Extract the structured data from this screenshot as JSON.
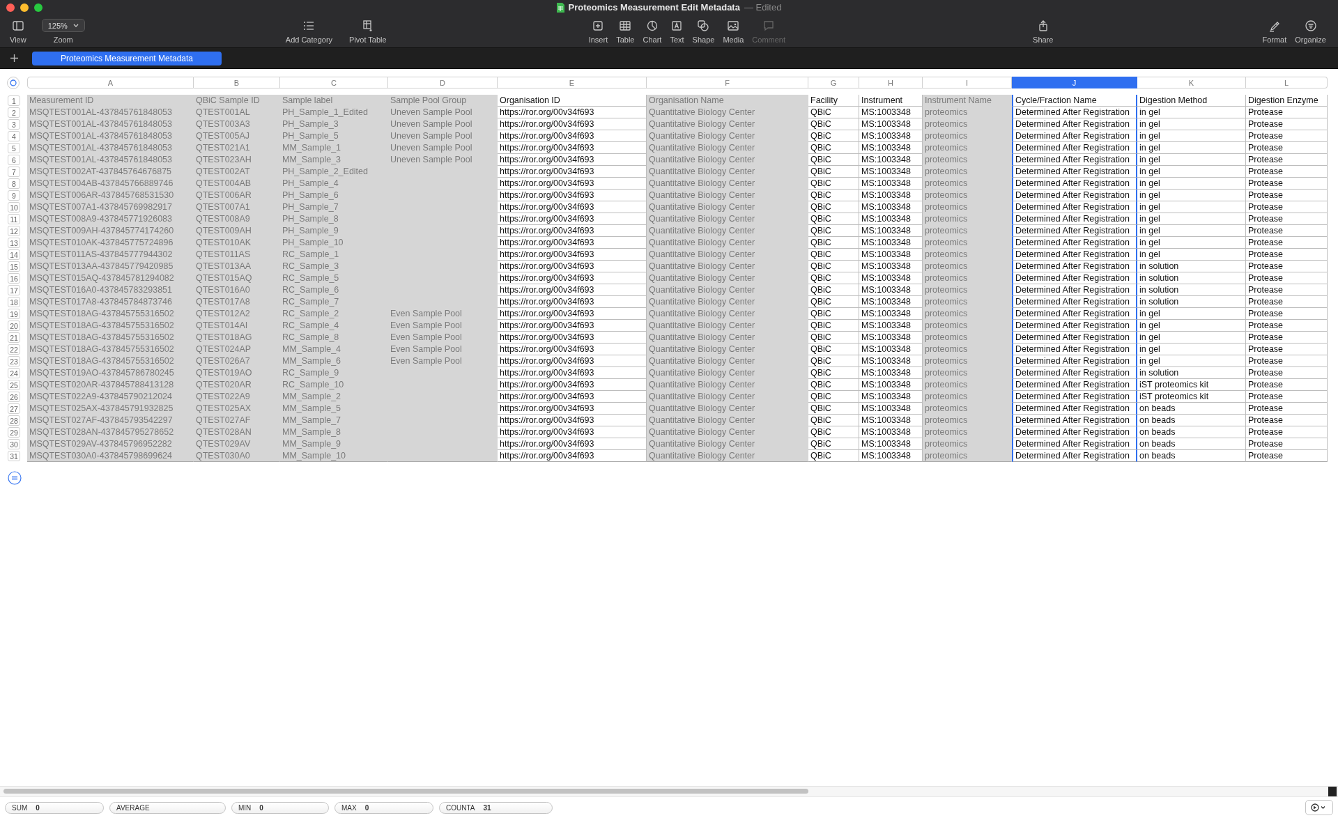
{
  "window": {
    "title": "Proteomics Measurement Edit Metadata",
    "status": "— Edited"
  },
  "toolbar": {
    "zoom_value": "125%",
    "items": [
      {
        "label": "View",
        "disabled": false
      },
      {
        "label": "Zoom",
        "disabled": false
      },
      {
        "label": "Add Category",
        "disabled": false
      },
      {
        "label": "Pivot Table",
        "disabled": false
      },
      {
        "label": "Insert",
        "disabled": false
      },
      {
        "label": "Table",
        "disabled": false
      },
      {
        "label": "Chart",
        "disabled": false
      },
      {
        "label": "Text",
        "disabled": false
      },
      {
        "label": "Shape",
        "disabled": false
      },
      {
        "label": "Media",
        "disabled": false
      },
      {
        "label": "Comment",
        "disabled": true
      },
      {
        "label": "Share",
        "disabled": false
      },
      {
        "label": "Format",
        "disabled": false
      },
      {
        "label": "Organize",
        "disabled": false
      }
    ]
  },
  "sheet_tabs": [
    {
      "label": "Proteomics Measurement Metadata",
      "selected": true
    }
  ],
  "table": {
    "columns": [
      {
        "letter": "A",
        "header": "Measurement ID",
        "editable": false,
        "selected": false
      },
      {
        "letter": "B",
        "header": "QBiC Sample ID",
        "editable": false,
        "selected": false
      },
      {
        "letter": "C",
        "header": "Sample label",
        "editable": false,
        "selected": false
      },
      {
        "letter": "D",
        "header": "Sample Pool Group",
        "editable": false,
        "selected": false
      },
      {
        "letter": "E",
        "header": "Organisation ID",
        "editable": true,
        "selected": false
      },
      {
        "letter": "F",
        "header": "Organisation Name",
        "editable": false,
        "selected": false
      },
      {
        "letter": "G",
        "header": "Facility",
        "editable": true,
        "selected": false
      },
      {
        "letter": "H",
        "header": "Instrument",
        "editable": true,
        "selected": false
      },
      {
        "letter": "I",
        "header": "Instrument Name",
        "editable": false,
        "selected": false
      },
      {
        "letter": "J",
        "header": "Cycle/Fraction Name",
        "editable": true,
        "selected": true
      },
      {
        "letter": "K",
        "header": "Digestion Method",
        "editable": true,
        "selected": false
      },
      {
        "letter": "L",
        "header": "Digestion Enzyme",
        "editable": true,
        "selected": false
      }
    ],
    "header_row_number": "1",
    "rows": [
      {
        "number": "2",
        "cells": [
          "MSQTEST001AL-437845761848053",
          "QTEST001AL",
          "PH_Sample_1_Edited",
          "Uneven Sample Pool",
          "https://ror.org/00v34f693",
          "Quantitative Biology Center",
          "QBiC",
          "MS:1003348",
          "proteomics",
          "Determined After Registration",
          "in gel",
          "Protease"
        ]
      },
      {
        "number": "3",
        "cells": [
          "MSQTEST001AL-437845761848053",
          "QTEST003A3",
          "PH_Sample_3",
          "Uneven Sample Pool",
          "https://ror.org/00v34f693",
          "Quantitative Biology Center",
          "QBiC",
          "MS:1003348",
          "proteomics",
          "Determined After Registration",
          "in gel",
          "Protease"
        ]
      },
      {
        "number": "4",
        "cells": [
          "MSQTEST001AL-437845761848053",
          "QTEST005AJ",
          "PH_Sample_5",
          "Uneven Sample Pool",
          "https://ror.org/00v34f693",
          "Quantitative Biology Center",
          "QBiC",
          "MS:1003348",
          "proteomics",
          "Determined After Registration",
          "in gel",
          "Protease"
        ]
      },
      {
        "number": "5",
        "cells": [
          "MSQTEST001AL-437845761848053",
          "QTEST021A1",
          "MM_Sample_1",
          "Uneven Sample Pool",
          "https://ror.org/00v34f693",
          "Quantitative Biology Center",
          "QBiC",
          "MS:1003348",
          "proteomics",
          "Determined After Registration",
          "in gel",
          "Protease"
        ]
      },
      {
        "number": "6",
        "cells": [
          "MSQTEST001AL-437845761848053",
          "QTEST023AH",
          "MM_Sample_3",
          "Uneven Sample Pool",
          "https://ror.org/00v34f693",
          "Quantitative Biology Center",
          "QBiC",
          "MS:1003348",
          "proteomics",
          "Determined After Registration",
          "in gel",
          "Protease"
        ]
      },
      {
        "number": "7",
        "cells": [
          "MSQTEST002AT-437845764676875",
          "QTEST002AT",
          "PH_Sample_2_Edited",
          null,
          "https://ror.org/00v34f693",
          "Quantitative Biology Center",
          "QBiC",
          "MS:1003348",
          "proteomics",
          "Determined After Registration",
          "in gel",
          "Protease"
        ]
      },
      {
        "number": "8",
        "cells": [
          "MSQTEST004AB-437845766889746",
          "QTEST004AB",
          "PH_Sample_4",
          null,
          "https://ror.org/00v34f693",
          "Quantitative Biology Center",
          "QBiC",
          "MS:1003348",
          "proteomics",
          "Determined After Registration",
          "in gel",
          "Protease"
        ]
      },
      {
        "number": "9",
        "cells": [
          "MSQTEST006AR-437845768531530",
          "QTEST006AR",
          "PH_Sample_6",
          null,
          "https://ror.org/00v34f693",
          "Quantitative Biology Center",
          "QBiC",
          "MS:1003348",
          "proteomics",
          "Determined After Registration",
          "in gel",
          "Protease"
        ]
      },
      {
        "number": "10",
        "cells": [
          "MSQTEST007A1-437845769982917",
          "QTEST007A1",
          "PH_Sample_7",
          null,
          "https://ror.org/00v34f693",
          "Quantitative Biology Center",
          "QBiC",
          "MS:1003348",
          "proteomics",
          "Determined After Registration",
          "in gel",
          "Protease"
        ]
      },
      {
        "number": "11",
        "cells": [
          "MSQTEST008A9-437845771926083",
          "QTEST008A9",
          "PH_Sample_8",
          null,
          "https://ror.org/00v34f693",
          "Quantitative Biology Center",
          "QBiC",
          "MS:1003348",
          "proteomics",
          "Determined After Registration",
          "in gel",
          "Protease"
        ]
      },
      {
        "number": "12",
        "cells": [
          "MSQTEST009AH-437845774174260",
          "QTEST009AH",
          "PH_Sample_9",
          null,
          "https://ror.org/00v34f693",
          "Quantitative Biology Center",
          "QBiC",
          "MS:1003348",
          "proteomics",
          "Determined After Registration",
          "in gel",
          "Protease"
        ]
      },
      {
        "number": "13",
        "cells": [
          "MSQTEST010AK-437845775724896",
          "QTEST010AK",
          "PH_Sample_10",
          null,
          "https://ror.org/00v34f693",
          "Quantitative Biology Center",
          "QBiC",
          "MS:1003348",
          "proteomics",
          "Determined After Registration",
          "in gel",
          "Protease"
        ]
      },
      {
        "number": "14",
        "cells": [
          "MSQTEST011AS-437845777944302",
          "QTEST011AS",
          "RC_Sample_1",
          null,
          "https://ror.org/00v34f693",
          "Quantitative Biology Center",
          "QBiC",
          "MS:1003348",
          "proteomics",
          "Determined After Registration",
          "in gel",
          "Protease"
        ]
      },
      {
        "number": "15",
        "cells": [
          "MSQTEST013AA-437845779420985",
          "QTEST013AA",
          "RC_Sample_3",
          null,
          "https://ror.org/00v34f693",
          "Quantitative Biology Center",
          "QBiC",
          "MS:1003348",
          "proteomics",
          "Determined After Registration",
          "in solution",
          "Protease"
        ]
      },
      {
        "number": "16",
        "cells": [
          "MSQTEST015AQ-437845781294082",
          "QTEST015AQ",
          "RC_Sample_5",
          null,
          "https://ror.org/00v34f693",
          "Quantitative Biology Center",
          "QBiC",
          "MS:1003348",
          "proteomics",
          "Determined After Registration",
          "in solution",
          "Protease"
        ]
      },
      {
        "number": "17",
        "cells": [
          "MSQTEST016A0-437845783293851",
          "QTEST016A0",
          "RC_Sample_6",
          null,
          "https://ror.org/00v34f693",
          "Quantitative Biology Center",
          "QBiC",
          "MS:1003348",
          "proteomics",
          "Determined After Registration",
          "in solution",
          "Protease"
        ]
      },
      {
        "number": "18",
        "cells": [
          "MSQTEST017A8-437845784873746",
          "QTEST017A8",
          "RC_Sample_7",
          null,
          "https://ror.org/00v34f693",
          "Quantitative Biology Center",
          "QBiC",
          "MS:1003348",
          "proteomics",
          "Determined After Registration",
          "in solution",
          "Protease"
        ]
      },
      {
        "number": "19",
        "cells": [
          "MSQTEST018AG-437845755316502",
          "QTEST012A2",
          "RC_Sample_2",
          "Even Sample Pool",
          "https://ror.org/00v34f693",
          "Quantitative Biology Center",
          "QBiC",
          "MS:1003348",
          "proteomics",
          "Determined After Registration",
          "in gel",
          "Protease"
        ]
      },
      {
        "number": "20",
        "cells": [
          "MSQTEST018AG-437845755316502",
          "QTEST014AI",
          "RC_Sample_4",
          "Even Sample Pool",
          "https://ror.org/00v34f693",
          "Quantitative Biology Center",
          "QBiC",
          "MS:1003348",
          "proteomics",
          "Determined After Registration",
          "in gel",
          "Protease"
        ]
      },
      {
        "number": "21",
        "cells": [
          "MSQTEST018AG-437845755316502",
          "QTEST018AG",
          "RC_Sample_8",
          "Even Sample Pool",
          "https://ror.org/00v34f693",
          "Quantitative Biology Center",
          "QBiC",
          "MS:1003348",
          "proteomics",
          "Determined After Registration",
          "in gel",
          "Protease"
        ]
      },
      {
        "number": "22",
        "cells": [
          "MSQTEST018AG-437845755316502",
          "QTEST024AP",
          "MM_Sample_4",
          "Even Sample Pool",
          "https://ror.org/00v34f693",
          "Quantitative Biology Center",
          "QBiC",
          "MS:1003348",
          "proteomics",
          "Determined After Registration",
          "in gel",
          "Protease"
        ]
      },
      {
        "number": "23",
        "cells": [
          "MSQTEST018AG-437845755316502",
          "QTEST026A7",
          "MM_Sample_6",
          "Even Sample Pool",
          "https://ror.org/00v34f693",
          "Quantitative Biology Center",
          "QBiC",
          "MS:1003348",
          "proteomics",
          "Determined After Registration",
          "in gel",
          "Protease"
        ]
      },
      {
        "number": "24",
        "cells": [
          "MSQTEST019AO-437845786780245",
          "QTEST019AO",
          "RC_Sample_9",
          null,
          "https://ror.org/00v34f693",
          "Quantitative Biology Center",
          "QBiC",
          "MS:1003348",
          "proteomics",
          "Determined After Registration",
          "in solution",
          "Protease"
        ]
      },
      {
        "number": "25",
        "cells": [
          "MSQTEST020AR-437845788413128",
          "QTEST020AR",
          "RC_Sample_10",
          null,
          "https://ror.org/00v34f693",
          "Quantitative Biology Center",
          "QBiC",
          "MS:1003348",
          "proteomics",
          "Determined After Registration",
          "iST proteomics kit",
          "Protease"
        ]
      },
      {
        "number": "26",
        "cells": [
          "MSQTEST022A9-437845790212024",
          "QTEST022A9",
          "MM_Sample_2",
          null,
          "https://ror.org/00v34f693",
          "Quantitative Biology Center",
          "QBiC",
          "MS:1003348",
          "proteomics",
          "Determined After Registration",
          "iST proteomics kit",
          "Protease"
        ]
      },
      {
        "number": "27",
        "cells": [
          "MSQTEST025AX-437845791932825",
          "QTEST025AX",
          "MM_Sample_5",
          null,
          "https://ror.org/00v34f693",
          "Quantitative Biology Center",
          "QBiC",
          "MS:1003348",
          "proteomics",
          "Determined After Registration",
          "on beads",
          "Protease"
        ]
      },
      {
        "number": "28",
        "cells": [
          "MSQTEST027AF-437845793542297",
          "QTEST027AF",
          "MM_Sample_7",
          null,
          "https://ror.org/00v34f693",
          "Quantitative Biology Center",
          "QBiC",
          "MS:1003348",
          "proteomics",
          "Determined After Registration",
          "on beads",
          "Protease"
        ]
      },
      {
        "number": "29",
        "cells": [
          "MSQTEST028AN-437845795278652",
          "QTEST028AN",
          "MM_Sample_8",
          null,
          "https://ror.org/00v34f693",
          "Quantitative Biology Center",
          "QBiC",
          "MS:1003348",
          "proteomics",
          "Determined After Registration",
          "on beads",
          "Protease"
        ]
      },
      {
        "number": "30",
        "cells": [
          "MSQTEST029AV-437845796952282",
          "QTEST029AV",
          "MM_Sample_9",
          null,
          "https://ror.org/00v34f693",
          "Quantitative Biology Center",
          "QBiC",
          "MS:1003348",
          "proteomics",
          "Determined After Registration",
          "on beads",
          "Protease"
        ]
      },
      {
        "number": "31",
        "cells": [
          "MSQTEST030A0-437845798699624",
          "QTEST030A0",
          "MM_Sample_10",
          null,
          "https://ror.org/00v34f693",
          "Quantitative Biology Center",
          "QBiC",
          "MS:1003348",
          "proteomics",
          "Determined After Registration",
          "on beads",
          "Protease"
        ]
      }
    ]
  },
  "status_bar": [
    {
      "label": "SUM",
      "value": "0"
    },
    {
      "label": "AVERAGE"
    },
    {
      "label": "MIN",
      "value": "0"
    },
    {
      "label": "MAX",
      "value": "0"
    },
    {
      "label": "COUNTA",
      "value": "31"
    }
  ]
}
